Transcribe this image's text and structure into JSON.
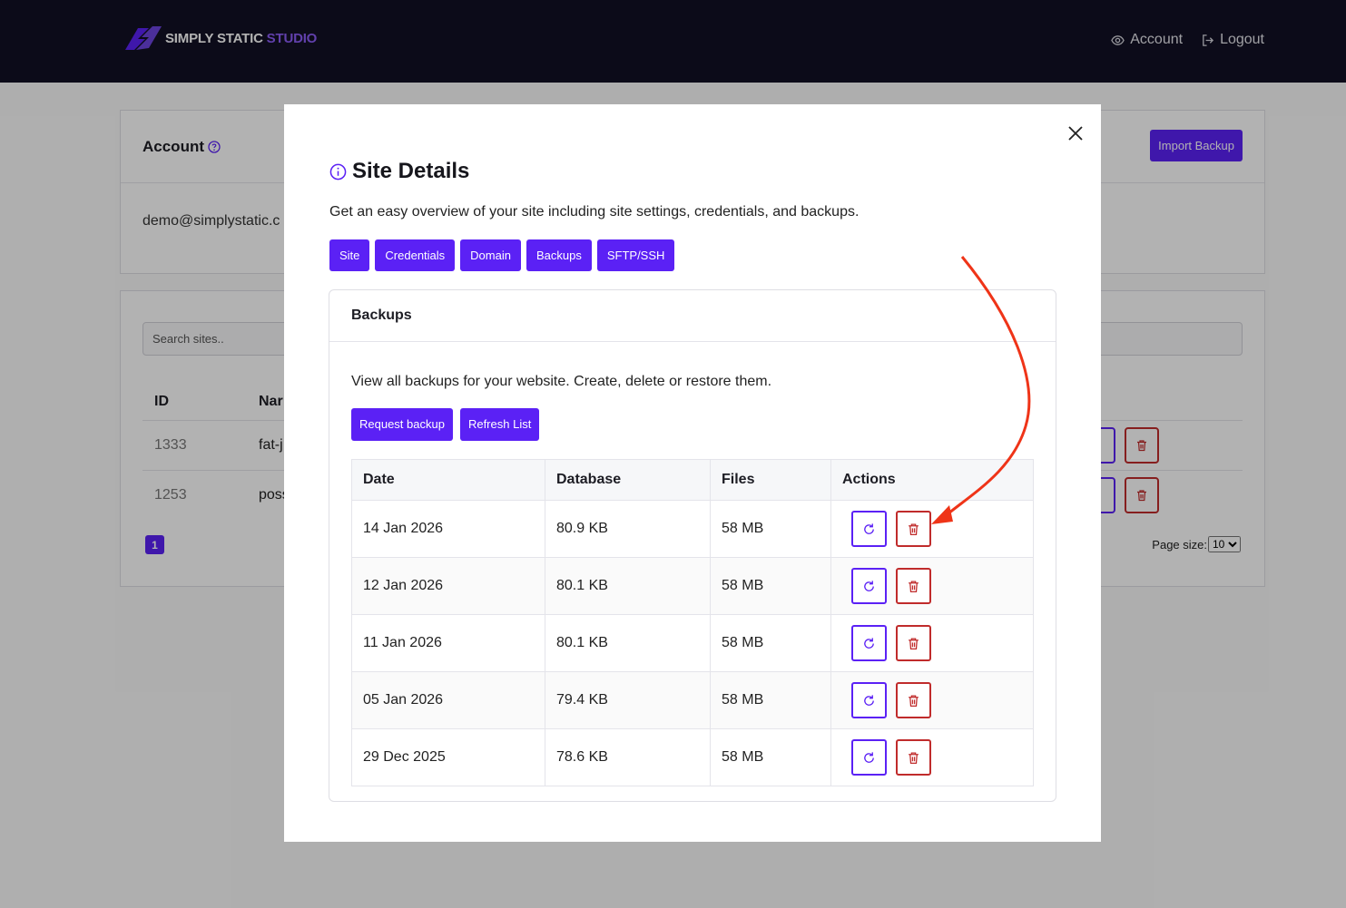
{
  "brand": {
    "word1": "SIMPLY STATIC",
    "word2": "STUDIO"
  },
  "nav": {
    "account": "Account",
    "logout": "Logout"
  },
  "account_card": {
    "title": "Account",
    "email": "demo@simplystatic.c",
    "import_button": "Import Backup"
  },
  "sites_card": {
    "search_placeholder": "Search sites..",
    "columns": [
      "ID",
      "Nar"
    ],
    "rows": [
      {
        "id": "1333",
        "name": "fat-j"
      },
      {
        "id": "1253",
        "name": "poss"
      }
    ],
    "page": "1",
    "page_size_label": "Page size:",
    "page_size_value": "10"
  },
  "modal": {
    "title": "Site Details",
    "subtitle": "Get an easy overview of your site including site settings, credentials, and backups.",
    "tabs": [
      "Site",
      "Credentials",
      "Domain",
      "Backups",
      "SFTP/SSH"
    ],
    "backups": {
      "title": "Backups",
      "description": "View all backups for your website. Create, delete or restore them.",
      "request_button": "Request backup",
      "refresh_button": "Refresh List",
      "columns": {
        "date": "Date",
        "database": "Database",
        "files": "Files",
        "actions": "Actions"
      },
      "rows": [
        {
          "date": "14 Jan 2026",
          "database": "80.9 KB",
          "files": "58 MB"
        },
        {
          "date": "12 Jan 2026",
          "database": "80.1 KB",
          "files": "58 MB"
        },
        {
          "date": "11 Jan 2026",
          "database": "80.1 KB",
          "files": "58 MB"
        },
        {
          "date": "05 Jan 2026",
          "database": "79.4 KB",
          "files": "58 MB"
        },
        {
          "date": "29 Dec 2025",
          "database": "78.6 KB",
          "files": "58 MB"
        }
      ]
    }
  },
  "icons": {
    "restore": "refresh-icon",
    "delete": "trash-icon",
    "close": "close-icon",
    "info": "info-icon",
    "help": "question-circle-icon",
    "account": "eye-icon",
    "logout": "logout-icon"
  },
  "colors": {
    "primary": "#5b21f5",
    "danger": "#c02b2b",
    "navbar": "#121124",
    "annotation_arrow": "#ef3418"
  }
}
